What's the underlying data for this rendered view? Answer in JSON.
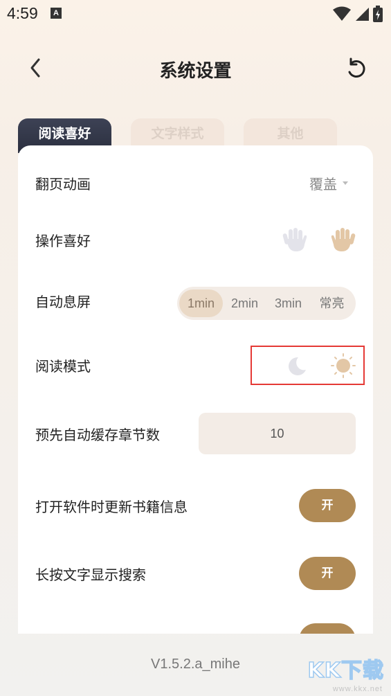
{
  "status_bar": {
    "time": "4:59",
    "notification_badge": "A"
  },
  "header": {
    "title": "系统设置"
  },
  "tabs": [
    {
      "label": "阅读喜好",
      "active": true
    },
    {
      "label": "文字样式",
      "active": false
    },
    {
      "label": "其他",
      "active": false
    }
  ],
  "settings": {
    "page_animation": {
      "label": "翻页动画",
      "value": "覆盖"
    },
    "operation_preference": {
      "label": "操作喜好",
      "selected": "right-hand"
    },
    "auto_screen_off": {
      "label": "自动息屏",
      "options": [
        "1min",
        "2min",
        "3min",
        "常亮"
      ],
      "selected": "1min"
    },
    "reading_mode": {
      "label": "阅读模式",
      "selected": "day"
    },
    "precache_chapters": {
      "label": "预先自动缓存章节数",
      "value": "10"
    },
    "update_book_info": {
      "label": "打开软件时更新书籍信息",
      "toggle": "开"
    },
    "long_press_search": {
      "label": "长按文字显示搜索",
      "toggle": "开"
    }
  },
  "footer": {
    "version": "V1.5.2.a_mihe"
  },
  "watermark": {
    "main": "KK下载",
    "url": "www.kkx.net"
  },
  "colors": {
    "accent": "#b08a55",
    "tab_active_bg": "#2b2f3f",
    "highlight_border": "#e53935"
  }
}
